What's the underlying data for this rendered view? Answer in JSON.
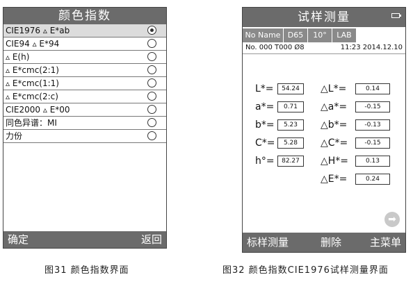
{
  "left_screen": {
    "title": "颜色指数",
    "items": [
      {
        "label": "CIE1976 ▵ E*ab",
        "selected": true
      },
      {
        "label": "CIE94 ▵ E*94",
        "selected": false
      },
      {
        "label": "▵ E(h)",
        "selected": false
      },
      {
        "label": "▵ E*cmc(2:1)",
        "selected": false
      },
      {
        "label": "▵ E*cmc(1:1)",
        "selected": false
      },
      {
        "label": "▵ E*cmc(2:c)",
        "selected": false
      },
      {
        "label": "CIE2000 ▵ E*00",
        "selected": false
      },
      {
        "label": "同色异谱：MI",
        "selected": false
      },
      {
        "label": "力份",
        "selected": false
      }
    ],
    "ok_label": "确定",
    "back_label": "返回"
  },
  "right_screen": {
    "title": "试样测量",
    "tabs": [
      "No Name",
      "D65",
      "10°",
      "LAB"
    ],
    "info_left": "No. 000  T000  Ø8",
    "info_right": "11:23  2014.12.10",
    "left_labels": [
      "L*=",
      "a*=",
      "b*=",
      "C*=",
      "h°="
    ],
    "left_values": [
      "54.24",
      "0.71",
      "5.23",
      "5.28",
      "82.27"
    ],
    "right_labels": [
      "△L*=",
      "△a*=",
      "△b*=",
      "△C*=",
      "△H*=",
      "△E*="
    ],
    "right_values": [
      "0.14",
      "-0.15",
      "-0.13",
      "-0.15",
      "0.13",
      "0.24"
    ],
    "bottom": [
      "标样测量",
      "删除",
      "主菜单"
    ]
  },
  "captions": {
    "left": "图31 颜色指数界面",
    "right": "图32 颜色指数CIE1976试样测量界面"
  }
}
